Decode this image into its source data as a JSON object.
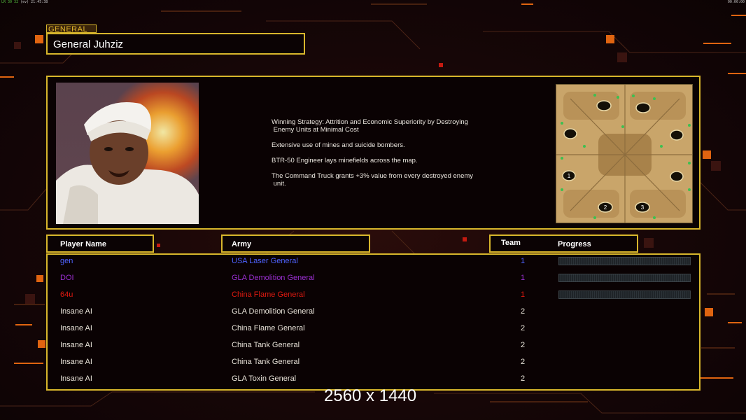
{
  "status_bar": {
    "left_green": "LR 30 32",
    "left_text": "(ev) 21:45:38",
    "right_text": "00:00:00"
  },
  "general": {
    "tab_label": "GENERAL",
    "name": "General Juhziz"
  },
  "description": [
    "Winning Strategy: Attrition and Economic Superiority by Destroying\n Enemy Units at Minimal Cost",
    "Extensive use of mines and suicide bombers.",
    "BTR-50 Engineer lays minefields across the map.",
    "The Command Truck grants +3% value from every destroyed enemy\n unit."
  ],
  "map": {
    "markers": [
      "1",
      "2",
      "3"
    ]
  },
  "table": {
    "headers": {
      "player": "Player Name",
      "army": "Army",
      "team": "Team",
      "progress": "Progress"
    },
    "rows": [
      {
        "player": "gen",
        "army": "USA Laser General",
        "team": "1",
        "color": "#4f63ff",
        "progress_fraction": 0
      },
      {
        "player": "DOI",
        "army": "GLA Demolition General",
        "team": "1",
        "color": "#9a2fd0",
        "progress_fraction": 0
      },
      {
        "player": "64u",
        "army": "China Flame General",
        "team": "1",
        "color": "#e01a10",
        "progress_fraction": 0
      },
      {
        "player": "Insane AI",
        "army": "GLA Demolition General",
        "team": "2",
        "color": "#e8e2d8"
      },
      {
        "player": "Insane AI",
        "army": "China Flame General",
        "team": "2",
        "color": "#e8e2d8"
      },
      {
        "player": "Insane AI",
        "army": "China Tank General",
        "team": "2",
        "color": "#e8e2d8"
      },
      {
        "player": "Insane AI",
        "army": "China Tank General",
        "team": "2",
        "color": "#e8e2d8"
      },
      {
        "player": "Insane AI",
        "army": "GLA Toxin General",
        "team": "2",
        "color": "#e8e2d8"
      }
    ]
  },
  "overlay": {
    "resolution": "2560 x 1440"
  },
  "colors": {
    "accent_gold": "#d8b62c",
    "background": "#140506"
  }
}
